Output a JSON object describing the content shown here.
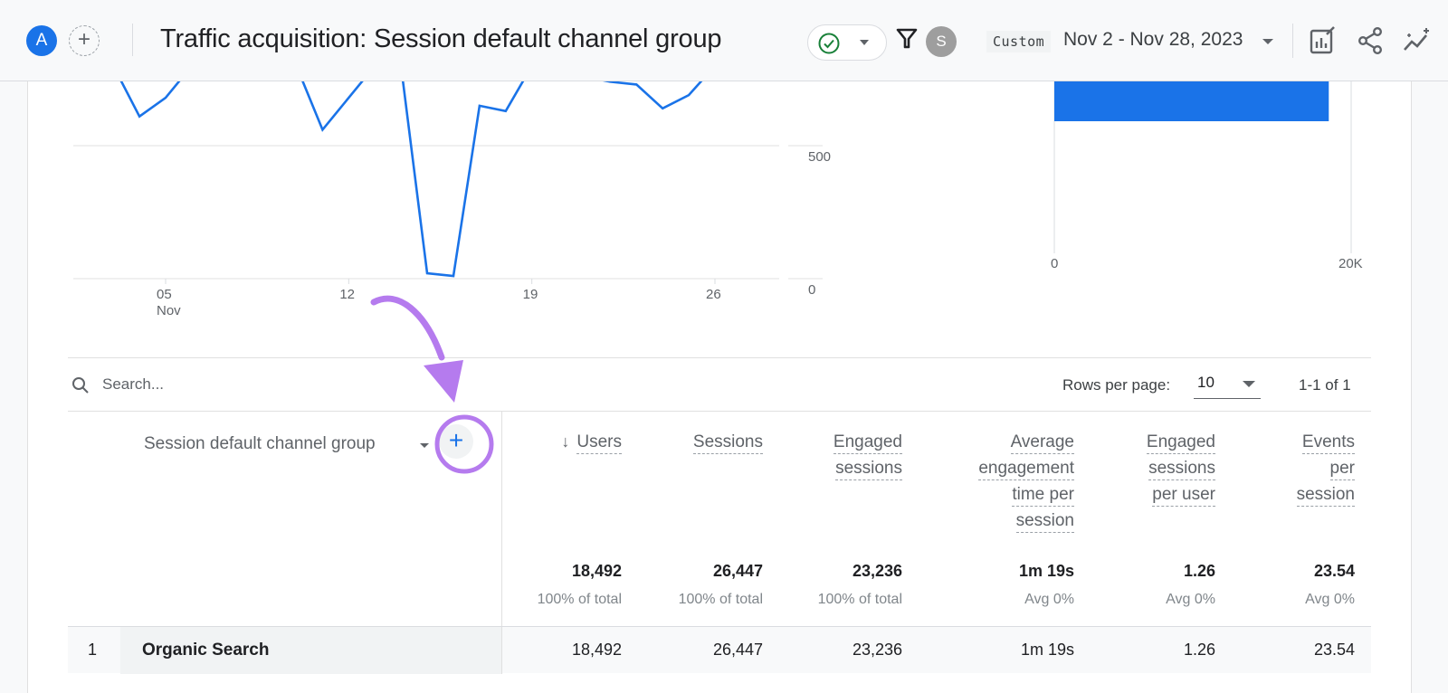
{
  "header": {
    "avatar_initial": "A",
    "add_comparison_symbol": "+",
    "title": "Traffic acquisition: Session default channel group",
    "user_initial": "S",
    "date_chip": "Custom",
    "date_range": "Nov 2 - Nov 28, 2023",
    "icons": [
      "check-circle-icon",
      "caret-down-icon",
      "filter-icon",
      "customize-report-icon",
      "share-icon",
      "insights-icon"
    ],
    "accent_color": "#1a73e8",
    "status_color": "#188038"
  },
  "chart_data": [
    {
      "type": "line",
      "title": "",
      "xlabel": "",
      "ylabel": "",
      "x_tick_labels": [
        "05\nNov",
        "12",
        "19",
        "26"
      ],
      "x_ticks": [
        {
          "label": "05",
          "sublabel": "Nov"
        },
        {
          "label": "12",
          "sublabel": ""
        },
        {
          "label": "19",
          "sublabel": ""
        },
        {
          "label": "26",
          "sublabel": ""
        }
      ],
      "y_tick_labels": [
        "0",
        "500"
      ],
      "visible_ylim": [
        0,
        730
      ],
      "grid": true,
      "series": [
        {
          "name": "Organic Search",
          "color": "#1a73e8",
          "x": [
            3,
            4,
            5,
            6,
            10,
            11,
            12,
            13,
            14,
            15,
            16,
            17,
            18,
            19,
            22,
            23,
            24,
            25,
            26
          ],
          "y": [
            800,
            610,
            680,
            800,
            800,
            560,
            680,
            800,
            800,
            20,
            10,
            650,
            630,
            800,
            740,
            730,
            640,
            690,
            800
          ],
          "note": "values above ~730 are clipped by the visible area"
        }
      ]
    },
    {
      "type": "bar",
      "orientation": "horizontal",
      "categories": [
        "Organic Search"
      ],
      "values": [
        18492
      ],
      "x_tick_labels": [
        "0",
        "20K"
      ],
      "xlim": [
        0,
        20000
      ],
      "color": "#1a73e8"
    }
  ],
  "table": {
    "search_placeholder": "Search...",
    "rows_per_page_label": "Rows per page:",
    "rows_per_page_value": "10",
    "pagination": "1-1 of 1",
    "dimension_header": "Session default channel group",
    "add_dimension_symbol": "+",
    "sort_arrow": "↓",
    "columns": [
      {
        "key": "users",
        "lines": [
          "Users"
        ],
        "total": "18,492",
        "sub": "100% of total",
        "sorted": true
      },
      {
        "key": "sessions",
        "lines": [
          "Sessions"
        ],
        "total": "26,447",
        "sub": "100% of total"
      },
      {
        "key": "engaged_sessions",
        "lines": [
          "Engaged",
          "sessions"
        ],
        "total": "23,236",
        "sub": "100% of total"
      },
      {
        "key": "avg_engagement",
        "lines": [
          "Average",
          "engagement",
          "time per",
          "session"
        ],
        "total": "1m 19s",
        "sub": "Avg 0%"
      },
      {
        "key": "engaged_per_user",
        "lines": [
          "Engaged",
          "sessions",
          "per user"
        ],
        "total": "1.26",
        "sub": "Avg 0%"
      },
      {
        "key": "events_per_session",
        "lines": [
          "Events",
          "per",
          "session"
        ],
        "total": "23.54",
        "sub": "Avg 0%"
      }
    ],
    "rows": [
      {
        "index": "1",
        "dimension": "Organic Search",
        "values": [
          "18,492",
          "26,447",
          "23,236",
          "1m 19s",
          "1.26",
          "23.54"
        ]
      }
    ]
  },
  "annotation": {
    "color": "#b57bee",
    "type": "arrow-and-circle",
    "target": "add-dimension-button"
  }
}
